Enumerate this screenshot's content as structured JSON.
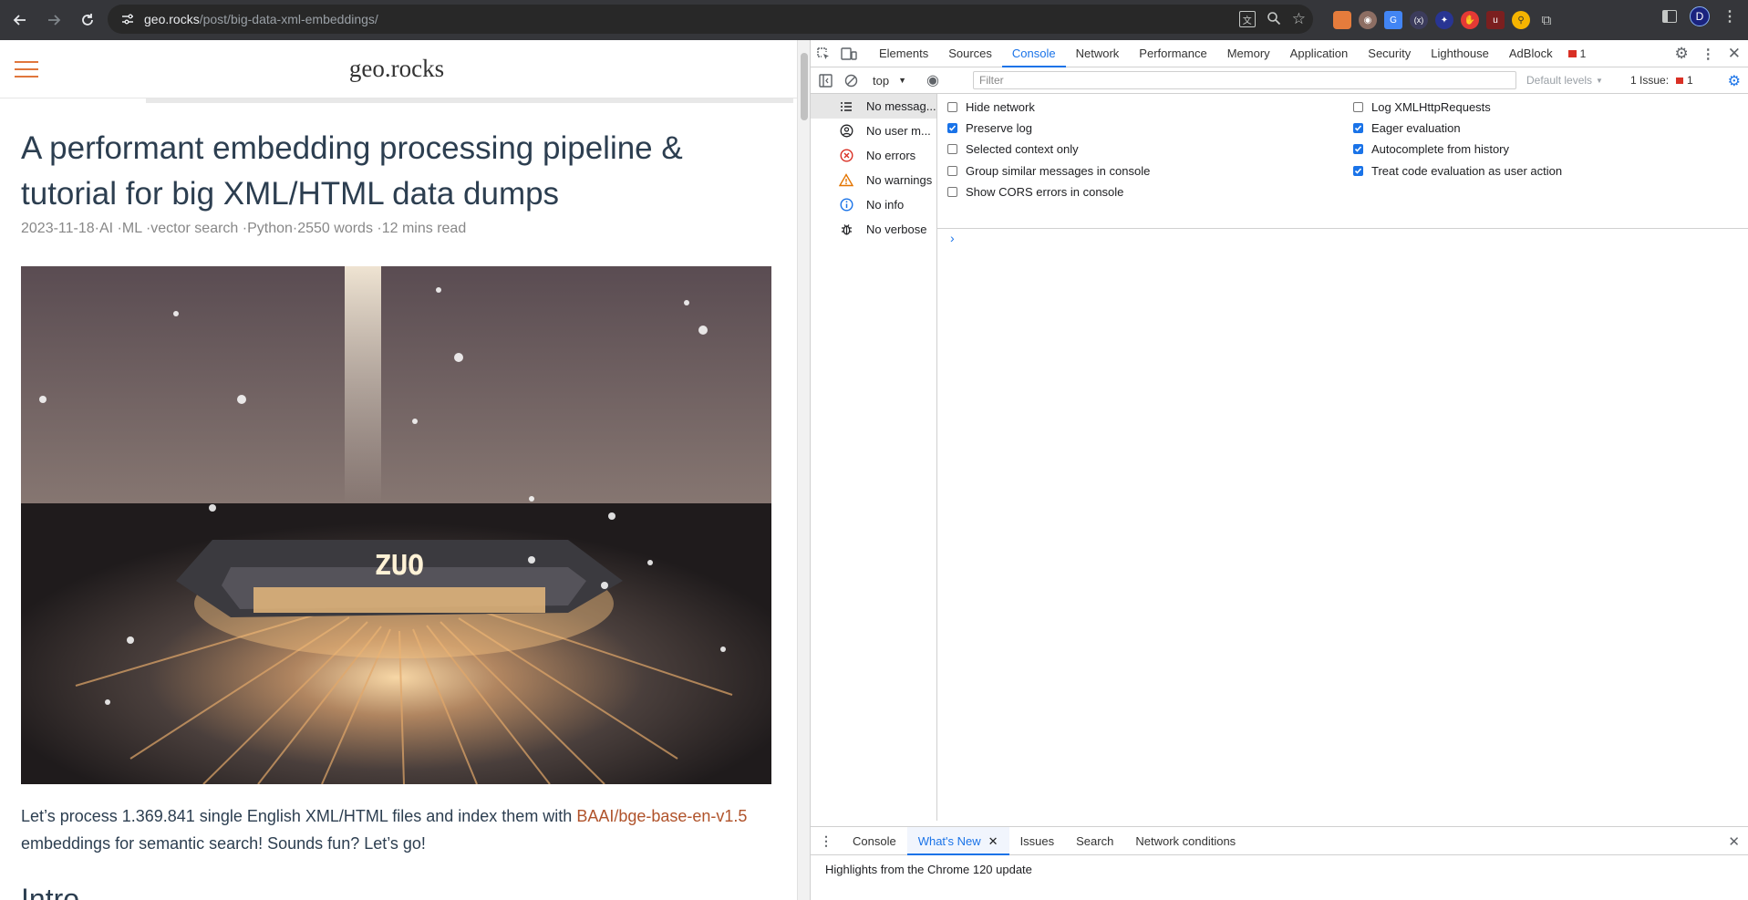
{
  "browser": {
    "url_host": "geo.rocks",
    "url_path": "/post/big-data-xml-embeddings/",
    "profile_initial": "D"
  },
  "page": {
    "site_title": "geo.rocks",
    "post_title": "A performant embedding processing pipeline & tutorial for big XML/HTML data dumps",
    "post_meta": "2023-11-18·AI ·ML ·vector search ·Python·2550 words ·12 mins read",
    "intro_before_link": "Let’s process 1.369.841 single English XML/HTML files and index them with ",
    "intro_link": "BAAI/bge-base-en-v1.5",
    "intro_after_link": " embeddings for semantic search! Sounds fun? Let’s go!",
    "next_heading": "Intro",
    "hero_text": "ZUO"
  },
  "devtools": {
    "tabs": [
      "Elements",
      "Sources",
      "Console",
      "Network",
      "Performance",
      "Memory",
      "Application",
      "Security",
      "Lighthouse",
      "AdBlock"
    ],
    "active_tab": "Console",
    "error_badge": "1",
    "context": "top",
    "filter_placeholder": "Filter",
    "levels": "Default levels",
    "issues_label": "1 Issue:",
    "issues_count": "1",
    "sidebar": [
      {
        "label": "No messag...",
        "icon": "list-icon"
      },
      {
        "label": "No user m...",
        "icon": "user-icon"
      },
      {
        "label": "No errors",
        "icon": "error-icon"
      },
      {
        "label": "No warnings",
        "icon": "warning-icon"
      },
      {
        "label": "No info",
        "icon": "info-icon"
      },
      {
        "label": "No verbose",
        "icon": "bug-icon"
      }
    ],
    "settings_left": [
      {
        "label": "Hide network",
        "checked": false
      },
      {
        "label": "Preserve log",
        "checked": true
      },
      {
        "label": "Selected context only",
        "checked": false
      },
      {
        "label": "Group similar messages in console",
        "checked": false
      },
      {
        "label": "Show CORS errors in console",
        "checked": false
      }
    ],
    "settings_right": [
      {
        "label": "Log XMLHttpRequests",
        "checked": false
      },
      {
        "label": "Eager evaluation",
        "checked": true
      },
      {
        "label": "Autocomplete from history",
        "checked": true
      },
      {
        "label": "Treat code evaluation as user action",
        "checked": true
      }
    ],
    "drawer_tabs": [
      "Console",
      "What's New",
      "Issues",
      "Search",
      "Network conditions"
    ],
    "drawer_active": "What's New",
    "whats_new_line": "Highlights from the Chrome 120 update"
  }
}
